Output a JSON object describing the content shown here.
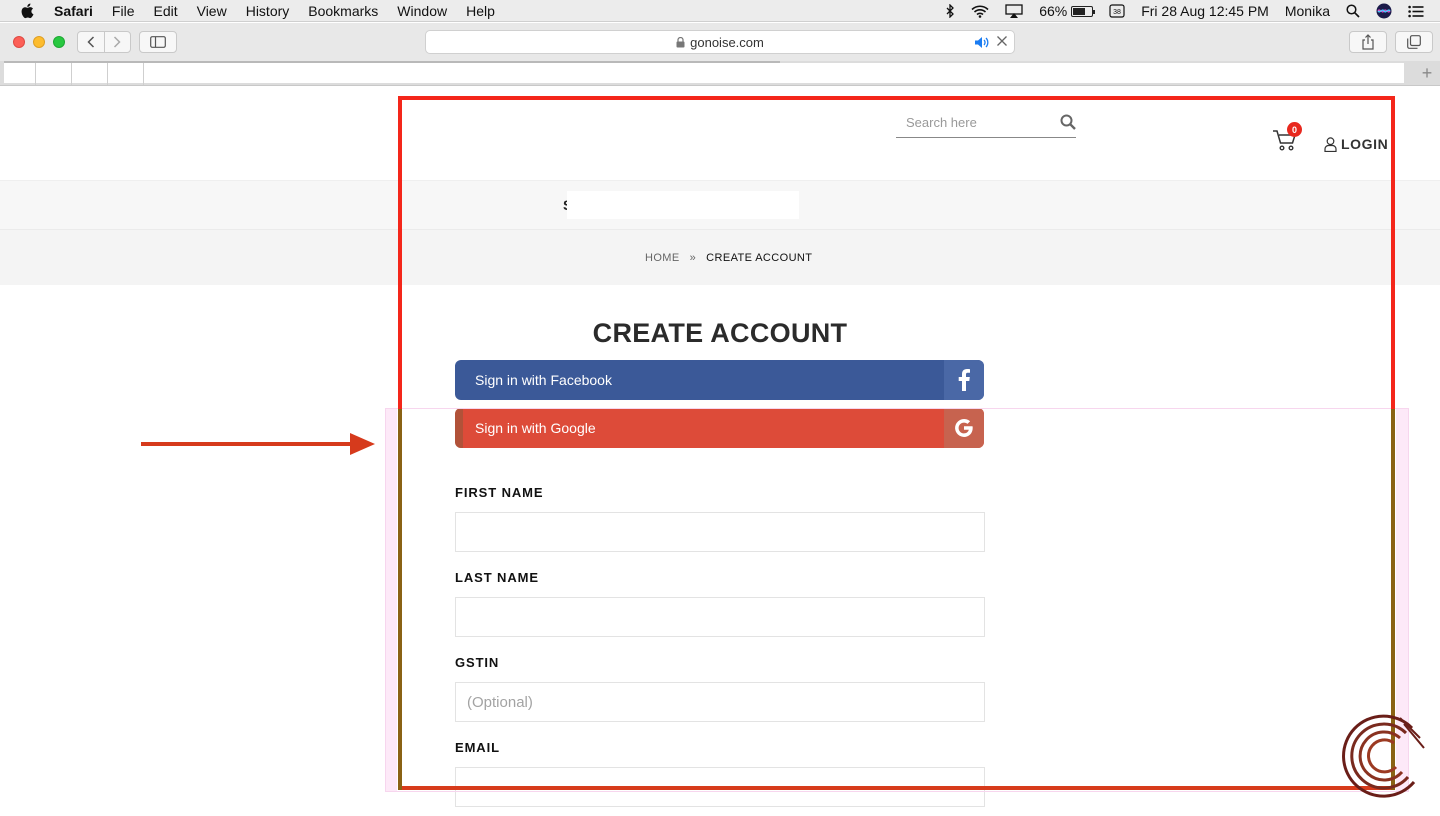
{
  "menubar": {
    "app_name": "Safari",
    "items": [
      "File",
      "Edit",
      "View",
      "History",
      "Bookmarks",
      "Window",
      "Help"
    ],
    "battery_percent": "66%",
    "battery_level": 0.66,
    "datetime": "Fri 28 Aug  12:45 PM",
    "user": "Monika",
    "icons": [
      "apple-icon",
      "bluetooth-icon",
      "wifi-icon",
      "airplay-icon",
      "battery-icon",
      "keyboard-icon",
      "spotlight-icon",
      "siri-icon",
      "notification-center-icon"
    ]
  },
  "browser": {
    "url": "gonoise.com",
    "icons": [
      "back-icon",
      "forward-icon",
      "sidebar-icon",
      "lock-icon",
      "speaker-icon",
      "close-icon",
      "share-icon",
      "tabs-icon",
      "new-tab-icon"
    ]
  },
  "header": {
    "search_placeholder": "Search here",
    "cart_count": "0",
    "login_label": "LOGIN"
  },
  "nav": {
    "visible_letter": "S"
  },
  "breadcrumb": {
    "home": "HOME",
    "separator": "»",
    "current": "CREATE ACCOUNT"
  },
  "form": {
    "title": "CREATE ACCOUNT",
    "facebook_label": "Sign in with Facebook",
    "google_label": "Sign in with Google",
    "first_name_label": "FIRST NAME",
    "last_name_label": "LAST NAME",
    "gstin_label": "GSTIN",
    "gstin_placeholder": "(Optional)",
    "email_label": "EMAIL"
  },
  "colors": {
    "facebook": "#3b5998",
    "google": "#dd4b39",
    "cart_badge": "#e8281e",
    "annotation_red": "#f4261a",
    "annotation_olive": "#8a6214"
  }
}
